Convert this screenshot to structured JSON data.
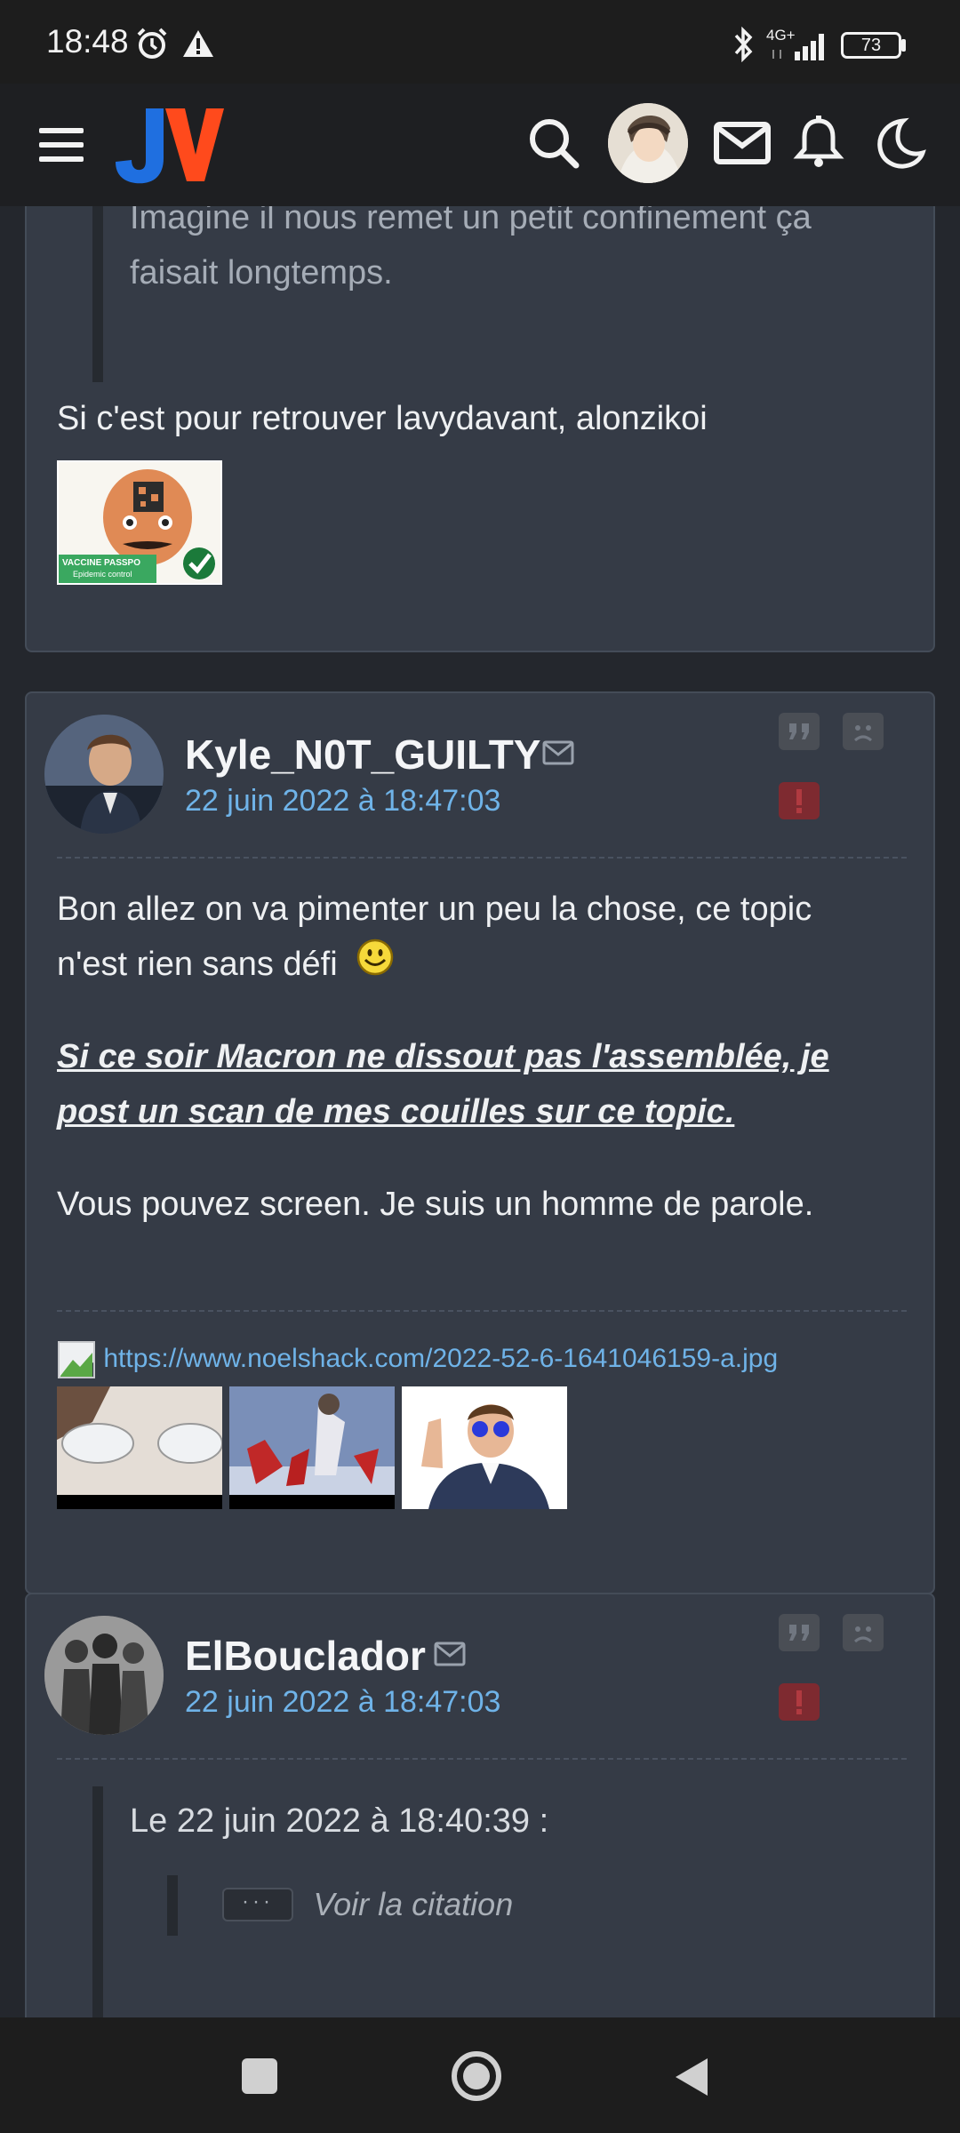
{
  "status_bar": {
    "time": "18:48",
    "network": "4G+",
    "battery": "73"
  },
  "header": {
    "logo_text": "JV"
  },
  "post1": {
    "quote": "Imagine il nous remet un petit confinement ça faisait longtemps.",
    "quote_line1": "Imagine il nous remet un petit confinement ça",
    "quote_line2": "faisait longtemps.",
    "text": "Si c'est pour retrouver lavydavant, alonzikoi",
    "sticker_caption": "VACCINE PASSPO",
    "sticker_caption2": "Epidemic control"
  },
  "post2": {
    "author": "Kyle_N0T_GUILTY",
    "date": "22 juin 2022 à 18:47:03",
    "para1_line1": "Bon allez on va pimenter un peu la chose, ce topic",
    "para1_line2": "n'est rien sans défi",
    "para2_line1": "Si ce soir Macron ne dissout pas l'assemblée, je",
    "para2_line2": "post un scan de mes couilles sur ce topic.",
    "para3": "Vous pouvez screen. Je suis un homme de parole.",
    "link": "https://www.noelshack.com/2022-52-6-1641046159-a.jpg"
  },
  "post3": {
    "author": "ElBouclador",
    "date": "22 juin 2022 à 18:47:03",
    "quote_header": "Le 22 juin 2022 à 18:40:39 :",
    "see_quote": "Voir la citation"
  },
  "colors": {
    "accent_blue": "#6fb3e8",
    "card_bg": "#353b46",
    "report_red": "#7e2a30",
    "logo_blue": "#1f6fe0",
    "logo_orange": "#ff4a1c"
  }
}
